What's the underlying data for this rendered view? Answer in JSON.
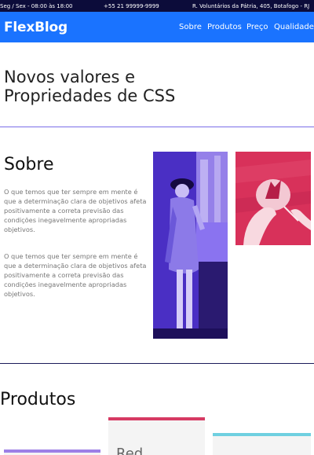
{
  "topbar": {
    "hours": "Seg / Sex - 08:00 às 18:00",
    "phone": "+55 21 99999-9999",
    "address": "R. Voluntários da Pátria, 405, Botafogo - RJ"
  },
  "header": {
    "logo": "FlexBlog",
    "nav": [
      "Sobre",
      "Produtos",
      "Preço",
      "Qualidade"
    ]
  },
  "hero": {
    "title_line1": "Novos valores e",
    "title_line2": "Propriedades de CSS"
  },
  "sobre": {
    "title": "Sobre",
    "paragraph1": "O que temos que ter sempre em mente é que a determinação clara de objetivos afeta positivamente a correta previsão das condições inegavelmente apropriadas objetivos.",
    "paragraph2": "O que temos que ter sempre em mente é que a determinação clara de objetivos afeta positivamente a correta previsão das condições inegavelmente apropriadas objetivos."
  },
  "produtos": {
    "title": "Produtos",
    "cards": [
      {
        "label": "",
        "accent": "#9d7fe6"
      },
      {
        "label": "Red",
        "accent": "#d63a63"
      },
      {
        "label": "",
        "accent": "#6fd0e0"
      }
    ]
  },
  "colors": {
    "topbar": "#0c0c3a",
    "header": "#1a73ff",
    "purple_divider": "#7b6ee8",
    "navy_divider": "#1a1a5a"
  },
  "icons": {
    "woman_photo": "woman-photo-icon",
    "hands_photo": "hands-photo-icon"
  }
}
